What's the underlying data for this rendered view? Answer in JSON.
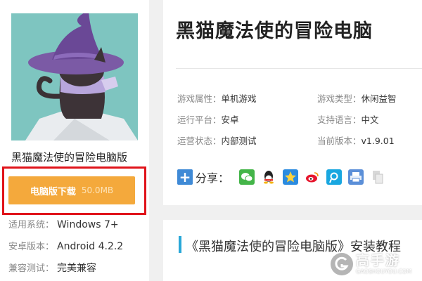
{
  "game": {
    "name": "黑猫魔法使的冒险电脑版",
    "title": "黑猫魔法使的冒险电脑"
  },
  "download": {
    "label": "电脑版下载",
    "size": "50.0MB"
  },
  "system": [
    {
      "label": "适用系统：",
      "value": "Windows 7+"
    },
    {
      "label": "安卓版本：",
      "value": "Android 4.2.2"
    },
    {
      "label": "兼容测试：",
      "value": "完美兼容"
    }
  ],
  "info": {
    "attr_label": "游戏属性：",
    "attr_value": "单机游戏",
    "type_label": "游戏类型：",
    "type_value": "休闲益智",
    "platform_label": "运行平台：",
    "platform_value": "安卓",
    "lang_label": "支持语言：",
    "lang_value": "中文",
    "status_label": "运营状态：",
    "status_value": "内部测试",
    "version_label": "当前版本：",
    "version_value": "v1.9.01"
  },
  "share": {
    "label": "分享：",
    "icons": [
      "wechat-icon",
      "qq-icon",
      "qzone-icon",
      "weibo-icon",
      "tencent-weibo-icon",
      "print-icon",
      "copy-icon"
    ]
  },
  "section": {
    "title": "《黑猫魔法使的冒险电脑版》安装教程"
  },
  "watermark": {
    "cn": "高手游",
    "en": "GAOSHOUYOU.COM"
  },
  "colors": {
    "download_button": "#f4a93c",
    "highlight_border": "#e0131a",
    "section_accent": "#29a8d8",
    "share_plus": "#3f8ad6"
  }
}
